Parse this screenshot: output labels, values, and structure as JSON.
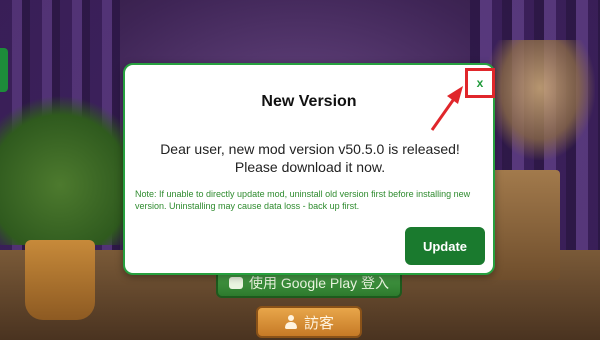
{
  "background": {
    "google_login_label": "使用 Google Play 登入",
    "guest_login_label": "訪客"
  },
  "dialog": {
    "title": "New Version",
    "close_label": "x",
    "message": "Dear user, new mod version v50.5.0 is released! Please download it now.",
    "note": "Note: If unable to directly update mod, uninstall old version first before installing new version. Uninstalling may cause data loss - back up first.",
    "update_label": "Update"
  },
  "colors": {
    "accent_green": "#1a7a2e",
    "annotation_red": "#e0262b",
    "note_green": "#2e8b2e"
  },
  "icons": [
    "google-play-icon",
    "person-icon",
    "close-icon",
    "arrow-annotation-icon"
  ]
}
